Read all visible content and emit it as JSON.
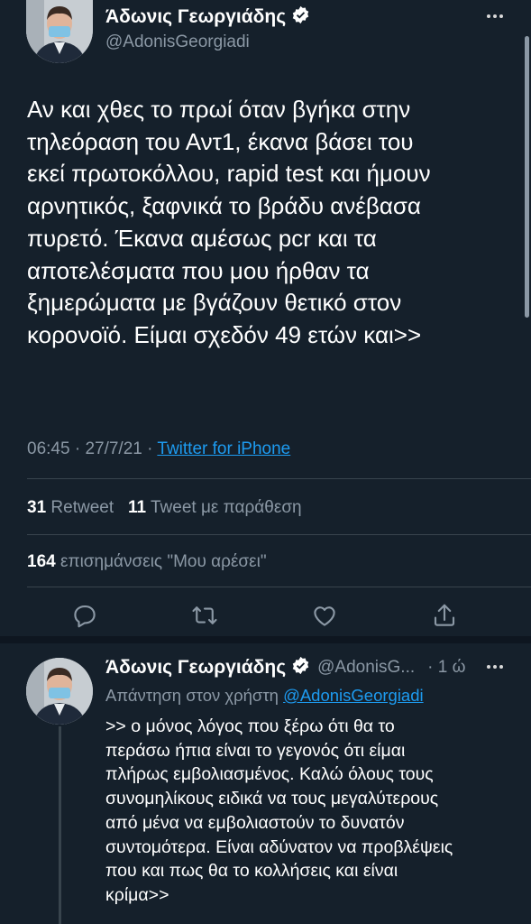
{
  "main_tweet": {
    "author_name": "Άδωνις Γεωργιάδης",
    "handle": "@AdonisGeorgiadi",
    "text": "Αν και χθες το πρωί όταν βγήκα στην\nτηλεόραση του Αντ1, έκανα βάσει του\nεκεί πρωτοκόλλου, rapid test και ήμουν\nαρνητικός, ξαφνικά το βράδυ ανέβασα\nπυρετό. Έκανα αμέσως pcr και τα\nαποτελέσματα που μου ήρθαν τα\nξημερώματα με βγάζουν θετικό στον\nκορονοϊό. Είμαι σχεδόν 49 ετών και>>",
    "time": "06:45",
    "date": "27/7/21",
    "separator": "·",
    "source": "Twitter for iPhone",
    "retweets_count": "31",
    "retweets_label": "Retweet",
    "quotes_count": "11",
    "quotes_label": "Tweet με παράθεση",
    "likes_count": "164",
    "likes_label": "επισημάνσεις \"Μου αρέσει\""
  },
  "icons": {
    "verified": "verified-badge-icon",
    "more": "more-icon",
    "reply": "reply-icon",
    "retweet": "retweet-icon",
    "like": "like-icon",
    "share": "share-icon"
  },
  "reply_tweet": {
    "author_name": "Άδωνις Γεωργιάδης",
    "handle": "@AdonisG...",
    "time_ago": "· 1 ώ",
    "replying_to_label": "Απάντηση στον χρήστη",
    "replying_to_handle": "@AdonisGeorgiadi",
    "text": ">> ο μόνος λόγος που ξέρω ότι θα το\nπεράσω ήπια είναι το γεγονός ότι είμαι\nπλήρως εμβολιασμένος. Καλώ όλους τους\nσυνομηλίκους ειδικά να τους μεγαλύτερους\nαπό μένα να εμβολιαστούν το δυνατόν\nσυντομότερα. Είναι αδύνατον να προβλέψεις\nπου και πως θα το κολλήσεις και είναι\nκρίμα>>"
  },
  "colors": {
    "background": "#15202b",
    "text": "#ffffff",
    "secondary": "#8b98a5",
    "link": "#1d9bf0",
    "divider": "#38444d"
  }
}
